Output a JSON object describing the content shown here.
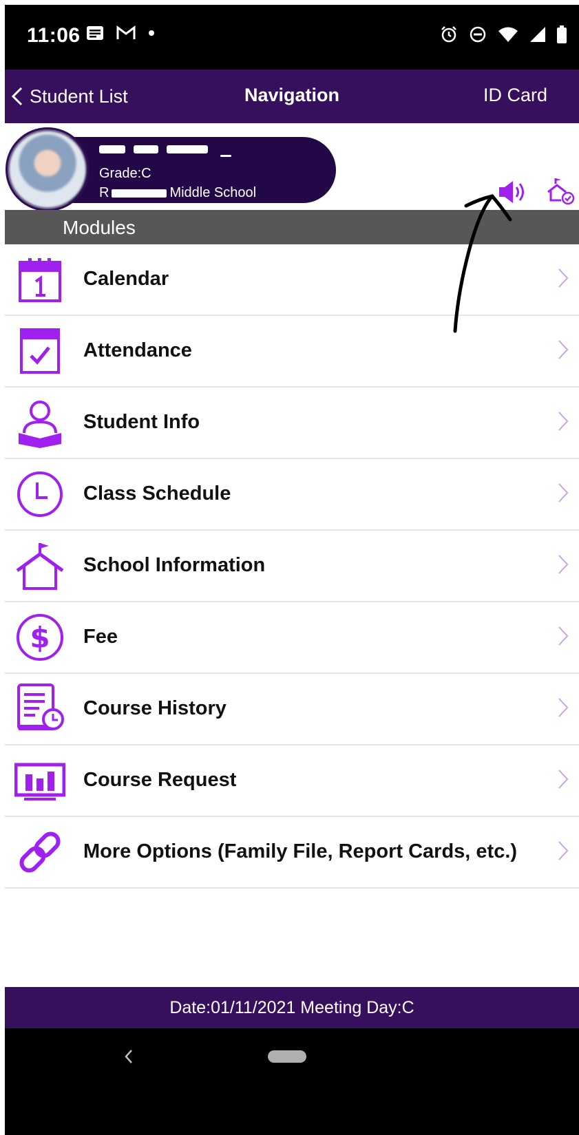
{
  "status_bar": {
    "time": "11:06"
  },
  "nav": {
    "back_label": "Student List",
    "title": "Navigation",
    "id_card_label": "ID Card"
  },
  "student": {
    "grade_label": "Grade:",
    "grade_partial": "C",
    "school_prefix": "R",
    "school_suffix": "Middle School"
  },
  "modules": {
    "header": "Modules"
  },
  "items": [
    {
      "label": "Calendar",
      "icon": "calendar-icon"
    },
    {
      "label": "Attendance",
      "icon": "attendance-icon"
    },
    {
      "label": "Student Info",
      "icon": "student-info-icon"
    },
    {
      "label": "Class Schedule",
      "icon": "clock-icon"
    },
    {
      "label": "School Information",
      "icon": "school-icon"
    },
    {
      "label": "Fee",
      "icon": "dollar-icon"
    },
    {
      "label": "Course History",
      "icon": "course-history-icon"
    },
    {
      "label": "Course Request",
      "icon": "course-request-icon"
    },
    {
      "label": "More Options (Family File, Report Cards, etc.)",
      "icon": "link-icon"
    }
  ],
  "footer": {
    "text": "Date:01/11/2021 Meeting Day:C"
  },
  "colors": {
    "accent": "#a020f0",
    "nav_bg": "#36105c",
    "pill_bg": "#220846",
    "modules_bg": "#575757",
    "chevron": "#c9a3e6"
  }
}
